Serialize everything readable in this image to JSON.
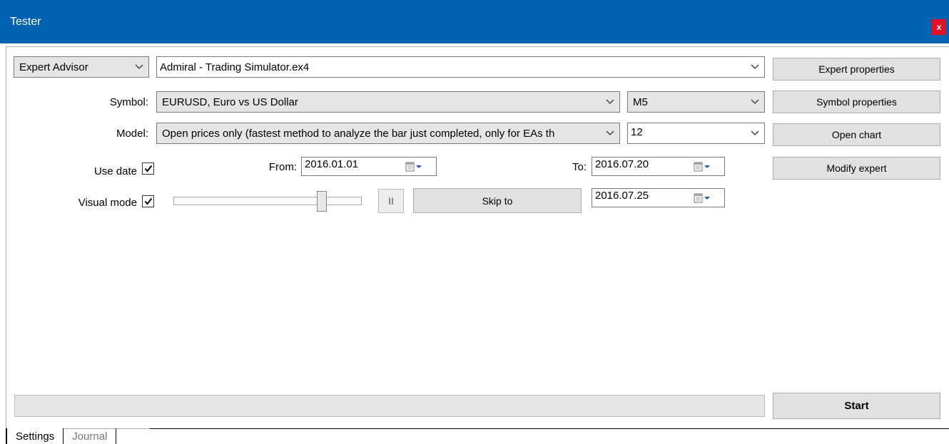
{
  "window": {
    "title": "Tester",
    "close": "x"
  },
  "expert": {
    "type_value": "Expert Advisor",
    "file_value": "Admiral - Trading Simulator.ex4",
    "properties_label": "Expert properties"
  },
  "symbol": {
    "label": "Symbol:",
    "value": "EURUSD, Euro vs US Dollar",
    "timeframe": "M5",
    "properties_label": "Symbol properties"
  },
  "model": {
    "label": "Model:",
    "value": "Open prices only (fastest method to analyze the bar just completed, only for EAs th",
    "spread": "12",
    "open_chart_label": "Open chart"
  },
  "dates": {
    "use_date_label": "Use date",
    "use_date_checked": true,
    "from_label": "From:",
    "from_value": "2016.01.01",
    "to_label": "To:",
    "to_value": "2016.07.20",
    "modify_label": "Modify expert"
  },
  "visual": {
    "label": "Visual mode",
    "checked": true,
    "slider_level": 0.8,
    "pause_label": "II",
    "skip_label": "Skip to",
    "skip_date": "2016.07.25"
  },
  "start_label": "Start",
  "tabs": [
    {
      "label": "Settings",
      "active": true
    },
    {
      "label": "Journal",
      "active": false
    }
  ],
  "colors": {
    "titlebar": "#0063b1",
    "close": "#e81123"
  }
}
